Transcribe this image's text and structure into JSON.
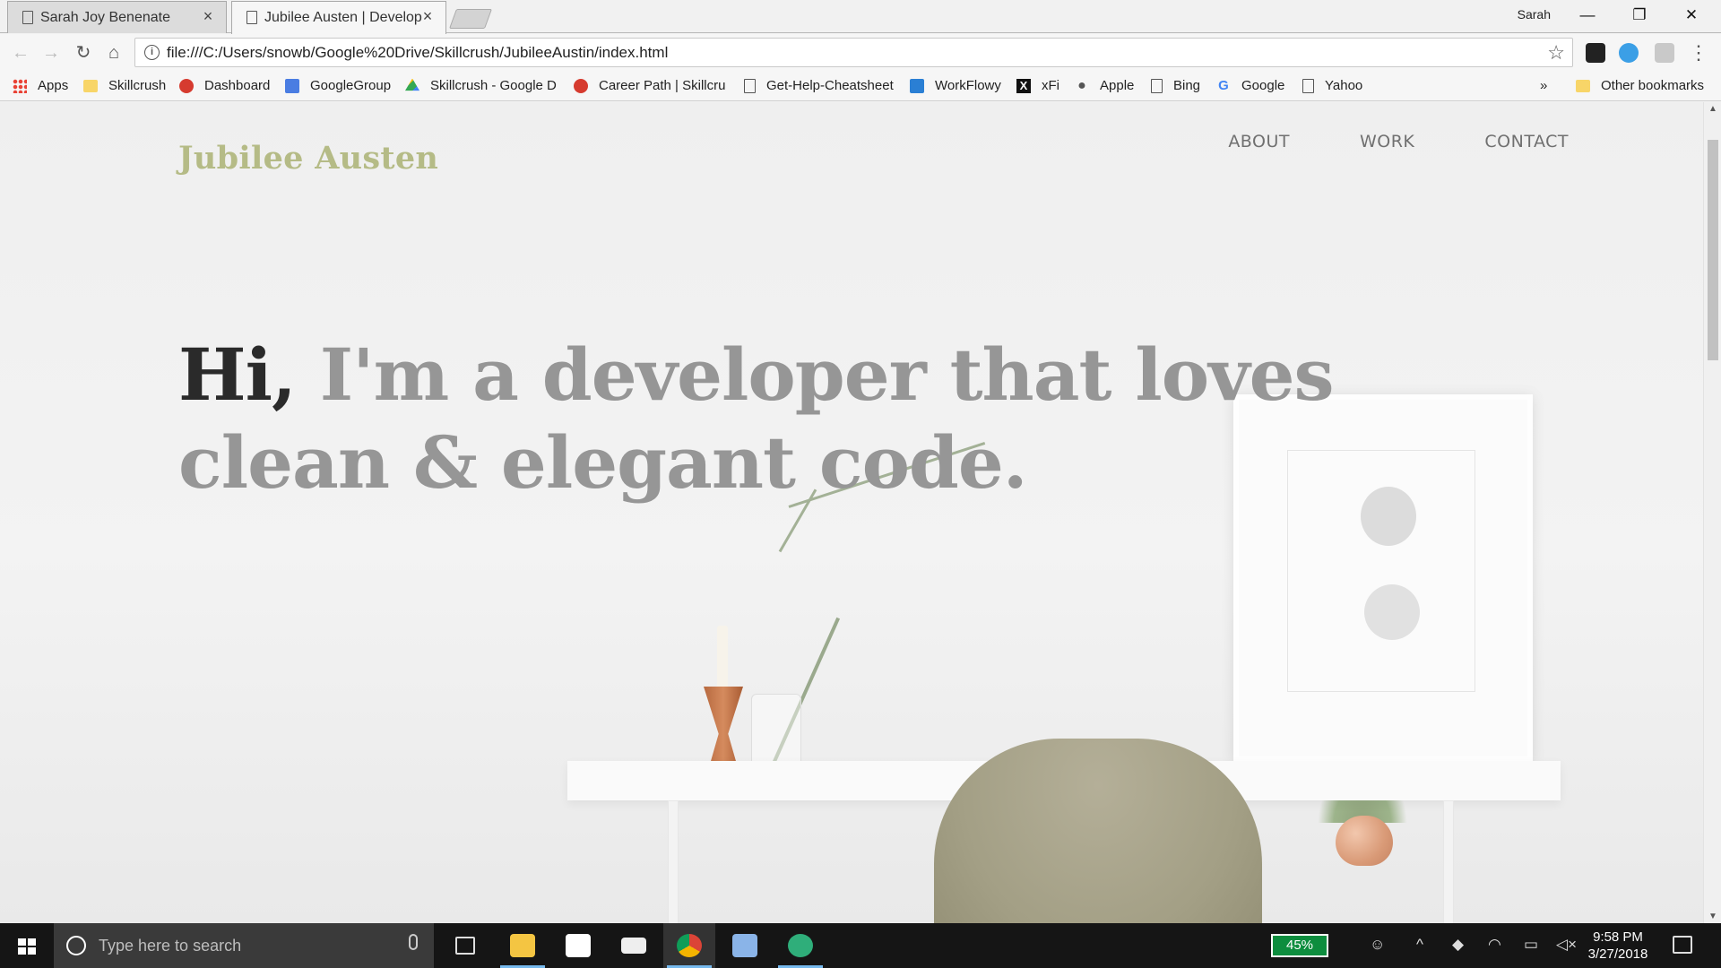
{
  "browser": {
    "tabs": [
      {
        "title": "Sarah Joy Benenate",
        "active": false
      },
      {
        "title": "Jubilee Austen | Develop",
        "active": true
      }
    ],
    "profile_name": "Sarah",
    "url": "file:///C:/Users/snowb/Google%20Drive/Skillcrush/JubileeAustin/index.html",
    "window_controls": {
      "minimize": "—",
      "restore": "❐",
      "close": "✕"
    },
    "bookmarks": [
      {
        "label": "Apps",
        "icon": "apps-icon"
      },
      {
        "label": "Skillcrush",
        "icon": "folder-icon"
      },
      {
        "label": "Dashboard",
        "icon": "skillcrush-icon"
      },
      {
        "label": "GoogleGroup",
        "icon": "google-groups-icon"
      },
      {
        "label": "Skillcrush - Google D",
        "icon": "google-drive-icon"
      },
      {
        "label": "Career Path | Skillcrus",
        "icon": "skillcrush-icon"
      },
      {
        "label": "Get-Help-Cheatsheet",
        "icon": "page-icon"
      },
      {
        "label": "WorkFlowy",
        "icon": "workflowy-icon"
      },
      {
        "label": "xFi",
        "icon": "xfi-icon"
      },
      {
        "label": "Apple",
        "icon": "apple-icon"
      },
      {
        "label": "Bing",
        "icon": "page-icon"
      },
      {
        "label": "Google",
        "icon": "google-icon"
      },
      {
        "label": "Yahoo",
        "icon": "page-icon"
      }
    ],
    "more_bookmarks": "»",
    "other_bookmarks": "Other bookmarks"
  },
  "site": {
    "logo": "Jubilee Austen",
    "nav": [
      "ABOUT",
      "WORK",
      "CONTACT"
    ],
    "hero_greeting": "Hi,",
    "hero_text": "I'm a developer that loves clean & elegant code."
  },
  "taskbar": {
    "search_placeholder": "Type here to search",
    "battery": "45%",
    "time": "9:58 PM",
    "date": "3/27/2018"
  },
  "colors": {
    "logo": "#b5bb86",
    "hero_greeting": "#2a2a2a",
    "hero_text": "#969696",
    "nav": "#707070",
    "battery": "#0d8d3e"
  }
}
